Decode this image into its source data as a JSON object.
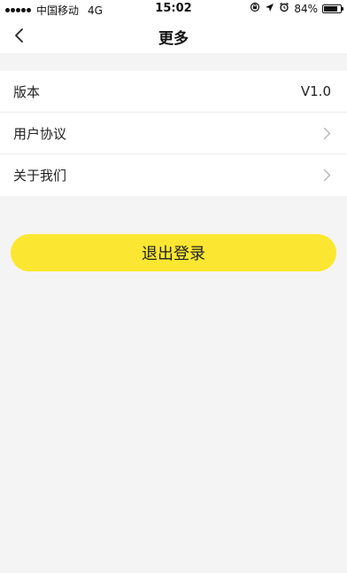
{
  "status_bar": {
    "carrier": "中国移动",
    "network": "4G",
    "time": "15:02",
    "battery_text": "84%",
    "battery_level": 0.84,
    "icons": [
      "signal-dots-icon",
      "rotation-lock-icon",
      "location-arrow-icon",
      "alarm-icon",
      "battery-icon"
    ]
  },
  "nav": {
    "title": "更多",
    "back_icon": "chevron-left-icon"
  },
  "list": {
    "items": [
      {
        "label": "版本",
        "value": "V1.0"
      },
      {
        "label": "用户协议",
        "icon": "chevron-right-icon"
      },
      {
        "label": "关于我们",
        "icon": "chevron-right-icon"
      }
    ]
  },
  "logout": {
    "label": "退出登录",
    "color": "#fbe731"
  },
  "colors": {
    "background": "#f4f4f4",
    "surface": "#ffffff",
    "accent": "#fbe731",
    "text": "#222222",
    "chevron": "#b5b5b5"
  }
}
